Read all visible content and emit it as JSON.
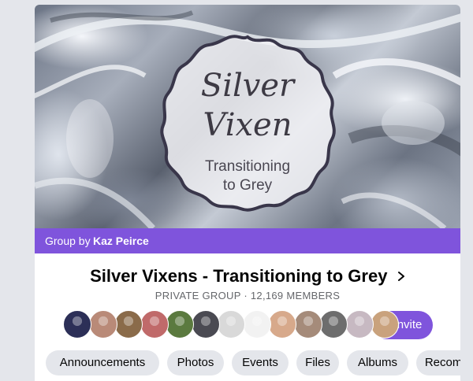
{
  "group": {
    "logo_line1": "Silver",
    "logo_line2": "Vixen",
    "logo_line3": "Transitioning",
    "logo_line4": "to Grey",
    "group_by_prefix": "Group by",
    "owner_name": "Kaz Peirce",
    "title": "Silver Vixens - Transitioning to Grey",
    "meta": "PRIVATE GROUP · 12,169 MEMBERS"
  },
  "actions": {
    "invite_label": "+ Invite"
  },
  "members": [
    {
      "name": "member-avatar-1",
      "color": "#2c2f57"
    },
    {
      "name": "member-avatar-2",
      "color": "#b98a78"
    },
    {
      "name": "member-avatar-3",
      "color": "#8a6b4a"
    },
    {
      "name": "member-avatar-4",
      "color": "#c06a6a"
    },
    {
      "name": "member-avatar-5",
      "color": "#5b7a3f"
    },
    {
      "name": "member-avatar-6",
      "color": "#4a4a52"
    },
    {
      "name": "member-avatar-7",
      "color": "#d9d9d9"
    },
    {
      "name": "member-avatar-8",
      "color": "#f2f2f2"
    },
    {
      "name": "member-avatar-9",
      "color": "#d7a98b"
    },
    {
      "name": "member-avatar-10",
      "color": "#a58b7a"
    },
    {
      "name": "member-avatar-11",
      "color": "#6d6d6d"
    },
    {
      "name": "member-avatar-12",
      "color": "#c7b9c2"
    },
    {
      "name": "member-avatar-13",
      "color": "#c9a27d"
    }
  ],
  "tabs": [
    {
      "label": "Announcements"
    },
    {
      "label": "Photos"
    },
    {
      "label": "Events"
    },
    {
      "label": "Files"
    },
    {
      "label": "Albums"
    },
    {
      "label": "Recomme"
    }
  ],
  "colors": {
    "accent": "#7f54dc",
    "pill_bg": "#e4e6eb",
    "page_bg": "#e4e6eb"
  }
}
